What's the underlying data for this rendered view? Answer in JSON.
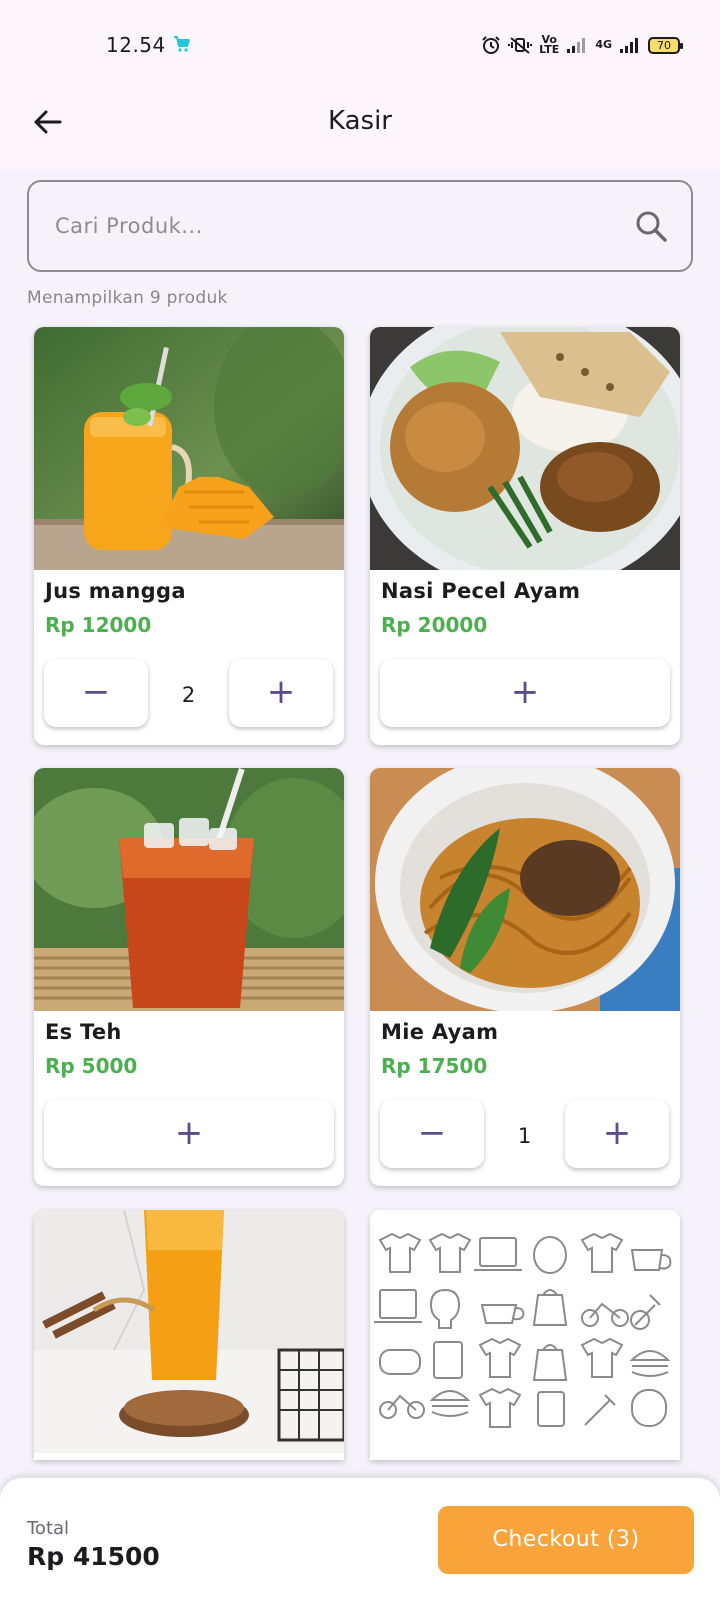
{
  "status_bar": {
    "time": "12.54",
    "volte_label": "Vo\nLTE",
    "network_label": "4G",
    "battery": "70"
  },
  "app_bar": {
    "title": "Kasir"
  },
  "search": {
    "placeholder": "Cari Produk..."
  },
  "product_count_text": "Menampilkan 9 produk",
  "products": [
    {
      "name": "Jus mangga",
      "price": "Rp 12000",
      "qty": "2"
    },
    {
      "name": "Nasi Pecel Ayam",
      "price": "Rp 20000",
      "qty": ""
    },
    {
      "name": "Es Teh",
      "price": "Rp 5000",
      "qty": ""
    },
    {
      "name": "Mie Ayam",
      "price": "Rp 17500",
      "qty": "1"
    }
  ],
  "buttons": {
    "minus": "−",
    "plus": "+"
  },
  "bottom_bar": {
    "total_label": "Total",
    "total_value": "Rp 41500",
    "checkout_label": "Checkout (3)"
  },
  "colors": {
    "accent_orange": "#f9a33b",
    "price_green": "#4caf50",
    "icon_purple": "#5e4b8b",
    "background": "#f6f2fa"
  }
}
